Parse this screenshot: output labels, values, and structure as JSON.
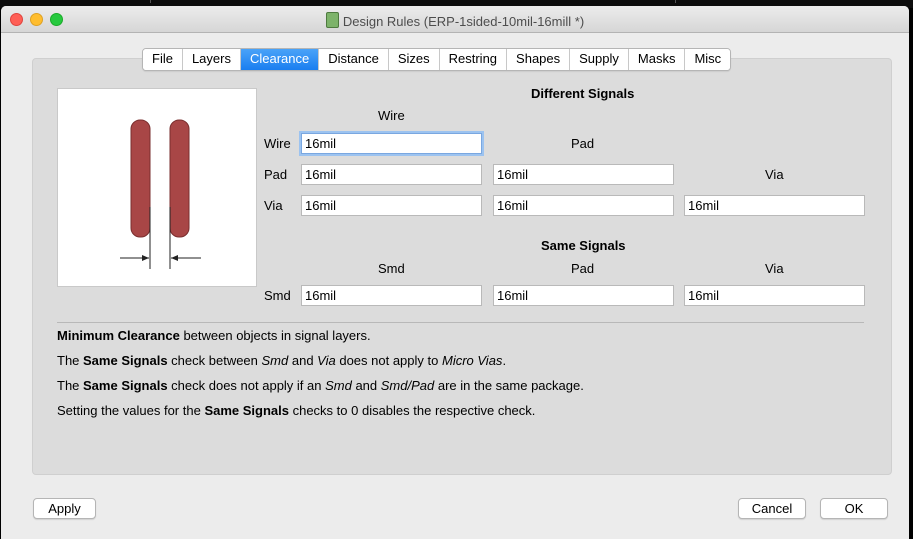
{
  "window": {
    "title": "Design Rules (ERP-1sided-10mil-16mill *)"
  },
  "tabs": [
    "File",
    "Layers",
    "Clearance",
    "Distance",
    "Sizes",
    "Restring",
    "Shapes",
    "Supply",
    "Masks",
    "Misc"
  ],
  "active_tab": "Clearance",
  "different_signals": {
    "heading": "Different Signals",
    "col_wire": "Wire",
    "col_pad": "Pad",
    "col_via": "Via",
    "row_wire": "Wire",
    "row_pad": "Pad",
    "row_via": "Via",
    "wire_wire": "16mil",
    "pad_wire": "16mil",
    "pad_pad": "16mil",
    "via_wire": "16mil",
    "via_pad": "16mil",
    "via_via": "16mil"
  },
  "same_signals": {
    "heading": "Same Signals",
    "col_smd": "Smd",
    "col_pad": "Pad",
    "col_via": "Via",
    "row_smd": "Smd",
    "smd_smd": "16mil",
    "smd_pad": "16mil",
    "smd_via": "16mil"
  },
  "info": {
    "line1_bold": "Minimum Clearance",
    "line1_rest": " between objects in signal layers.",
    "line2_a": "The ",
    "line2_bold": "Same Signals",
    "line2_b": " check between ",
    "line2_i1": "Smd",
    "line2_c": " and ",
    "line2_i2": "Via",
    "line2_d": " does not apply to ",
    "line2_i3": "Micro Vias",
    "line2_e": ".",
    "line3_a": "The ",
    "line3_bold": "Same Signals",
    "line3_b": " check does not apply if an ",
    "line3_i1": "Smd",
    "line3_c": " and ",
    "line3_i2": "Smd/Pad",
    "line3_d": " are in the same package.",
    "line4_a": "Setting the values for the ",
    "line4_bold": "Same Signals",
    "line4_b": " checks to 0 disables the respective check."
  },
  "buttons": {
    "apply": "Apply",
    "cancel": "Cancel",
    "ok": "OK"
  },
  "colors": {
    "trace": "#a84646",
    "tab_active": "#1a7ef0"
  }
}
